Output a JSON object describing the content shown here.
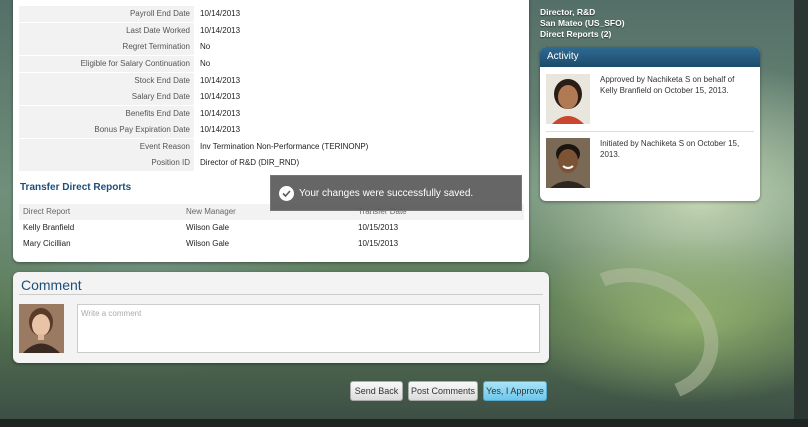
{
  "details": [
    {
      "label": "Payroll End Date",
      "value": "10/14/2013"
    },
    {
      "label": "Last Date Worked",
      "value": "10/14/2013"
    },
    {
      "label": "Regret Termination",
      "value": "No"
    },
    {
      "label": "Eligible for Salary Continuation",
      "value": "No"
    },
    {
      "label": "Stock End Date",
      "value": "10/14/2013"
    },
    {
      "label": "Salary End Date",
      "value": "10/14/2013"
    },
    {
      "label": "Benefits End Date",
      "value": "10/14/2013"
    },
    {
      "label": "Bonus Pay Expiration Date",
      "value": "10/14/2013"
    },
    {
      "label": "Event Reason",
      "value": "Inv Termination  Non-Performance (TERINONP)"
    },
    {
      "label": "Position ID",
      "value": "Director of R&D (DIR_RND)"
    }
  ],
  "transfer": {
    "title": "Transfer Direct Reports",
    "headers": [
      "Direct Report",
      "New Manager",
      "Transfer Date"
    ],
    "rows": [
      [
        "Kelly Branfield",
        "Wilson Gale",
        "10/15/2013"
      ],
      [
        "Mary Cicillian",
        "Wilson Gale",
        "10/15/2013"
      ]
    ]
  },
  "toast": {
    "message": "Your changes were successfully saved.",
    "icon": "checkmark-circle-icon"
  },
  "comment": {
    "title": "Comment",
    "placeholder": "Write a comment"
  },
  "buttons": {
    "send_back": "Send Back",
    "post_comments": "Post Comments",
    "approve": "Yes, I Approve"
  },
  "employee": {
    "title": "Director, R&D",
    "location": "San Mateo (US_SFO)",
    "direct_reports": "Direct Reports (2)"
  },
  "activity": {
    "title": "Activity",
    "items": [
      {
        "text": "Approved by Nachiketa S on behalf of Kelly Branfield on October 15, 2013."
      },
      {
        "text": "Initiated by Nachiketa S on October 15, 2013."
      }
    ]
  },
  "colors": {
    "accent": "#1d4f7a",
    "approve_button": "#6cc8ec",
    "activity_header": "#1c4b6c"
  }
}
